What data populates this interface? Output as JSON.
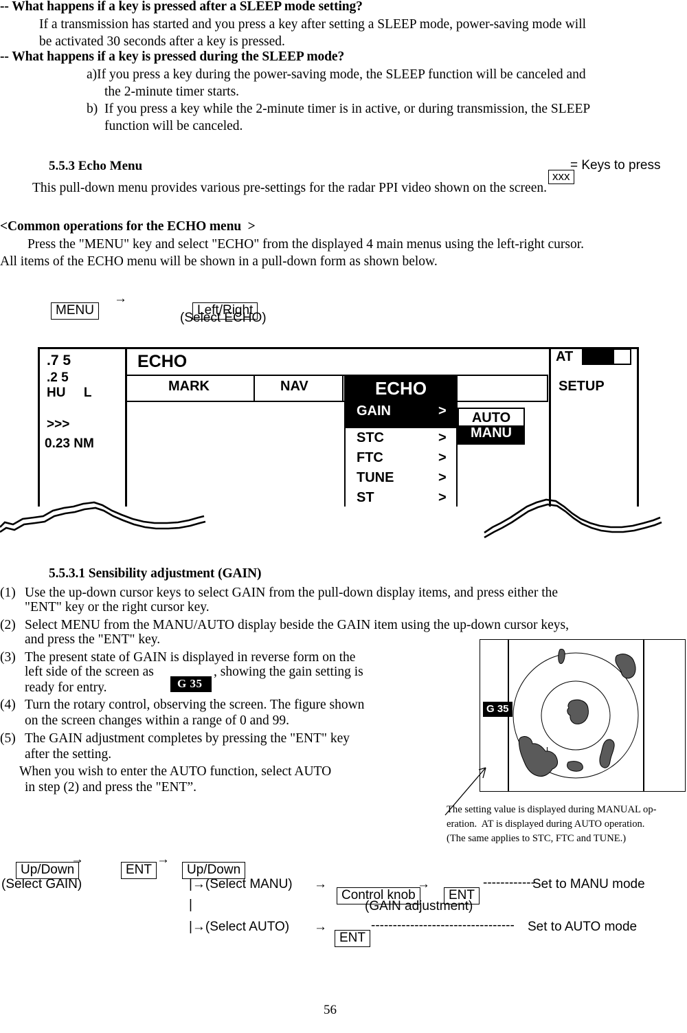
{
  "faq": {
    "q1": "-- What happens if a key is pressed after a SLEEP mode setting?",
    "q1_a_line1": "If a transmission has started and you press a key after setting a SLEEP mode, power-saving mode will",
    "q1_a_line2": "be activated 30 seconds after a key is pressed.",
    "q2": "-- What happens if a key is pressed during the SLEEP mode?",
    "q2_a_line1": "a)If you press a key during the power-saving mode, the SLEEP function will be canceled and",
    "q2_a_line2": "the 2-minute timer starts.",
    "q2_b_line1": "b)  If you press a key while the 2-minute timer is in active, or during transmission, the SLEEP",
    "q2_b_line2": "function will be canceled."
  },
  "section": {
    "heading": "5.5.3 Echo Menu",
    "legend_box": "xxx",
    "legend_text": "= Keys to press",
    "intro": "This pull-down menu provides various pre-settings for the radar PPI video shown on the screen.",
    "common_heading": "<Common operations for the ECHO menu  >",
    "common_line1": "Press the \"MENU\" key and select \"ECHO\" from the displayed 4 main menus using the left-right cursor.",
    "common_line2": "All items of the ECHO menu will be shown in a pull-down form as shown below."
  },
  "keyflow_top": {
    "menu_key": "MENU",
    "arrow": "→",
    "leftright_key": "Left/Right",
    "note": "(Select ECHO)"
  },
  "menu_mock": {
    "sidebar": {
      "l1": ".7 5",
      "l2": ".2 5",
      "l3": "HU     L",
      "l4": ">>>",
      "l5": "0.23 NM"
    },
    "title": "ECHO",
    "tabs": [
      {
        "label": "MARK",
        "selected": false
      },
      {
        "label": "NAV",
        "selected": false
      },
      {
        "label": "ECHO",
        "selected": true
      },
      {
        "label": "SETUP",
        "selected": false
      }
    ],
    "items": [
      {
        "label": "GAIN",
        "arrow": ">",
        "selected": true
      },
      {
        "label": "STC",
        "arrow": ">",
        "selected": false
      },
      {
        "label": "FTC",
        "arrow": ">",
        "selected": false
      },
      {
        "label": "TUNE",
        "arrow": ">",
        "selected": false
      },
      {
        "label": "ST",
        "arrow": ">",
        "selected": false
      }
    ],
    "submenu": [
      {
        "label": "AUTO",
        "selected": false
      },
      {
        "label": "MANU",
        "selected": true
      }
    ],
    "at_label": "AT"
  },
  "procedure": {
    "heading": "5.5.3.1 Sensibility adjustment (GAIN)",
    "steps": [
      {
        "num": "(1)",
        "lines": [
          "Use the up-down cursor keys to select GAIN from the pull-down display items, and press either the",
          "\"ENT\" key or the right cursor key."
        ]
      },
      {
        "num": "(2)",
        "lines": [
          "Select MENU from the MANU/AUTO display beside the GAIN item using the up-down cursor keys,",
          "and press the \"ENT\" key."
        ]
      },
      {
        "num": "(3)",
        "lines": [
          "The present state of GAIN is displayed in reverse form on the",
          "left side of the screen as",
          "ready for entry."
        ],
        "badge": "G 35",
        "line2_tail": ", showing the gain setting is"
      },
      {
        "num": "(4)",
        "lines": [
          "Turn the rotary control, observing the screen. The figure shown",
          "on the screen changes within a range of 0 and 99."
        ]
      },
      {
        "num": "(5)",
        "lines": [
          "The GAIN adjustment completes by pressing the \"ENT\" key",
          "after the setting."
        ]
      }
    ],
    "tail_line1": "When you wish to enter the AUTO function, select AUTO",
    "tail_line2": "in step (2) and press the \"ENT”."
  },
  "radar": {
    "gain_badge": "G 35",
    "caption_l1": "The setting value is displayed during MANUAL op-",
    "caption_l2": "eration.  AT is displayed during AUTO operation.",
    "caption_l3": "(The same applies to STC, FTC and TUNE.)"
  },
  "keyflow_bottom": {
    "k1": "Up/Down",
    "a1": "→",
    "k2": "ENT",
    "a2": "→",
    "k3": "Up/Down",
    "label1": "(Select GAIN)",
    "branch1": "|→(Select MANU)",
    "branch1_arrow": "→",
    "branch1_key": "Control knob",
    "branch1_arrow2": "→",
    "branch1_key2": "ENT",
    "branch1_dashes": "------------",
    "branch1_result": "Set to MANU mode",
    "branch1_note": "(GAIN adjustment)",
    "pipe": "|",
    "branch2": "|→(Select AUTO)",
    "branch2_arrow": "→",
    "branch2_key": "ENT",
    "branch2_dashes": "---------------------------------",
    "branch2_result": "Set to AUTO mode"
  },
  "page_number": "56"
}
